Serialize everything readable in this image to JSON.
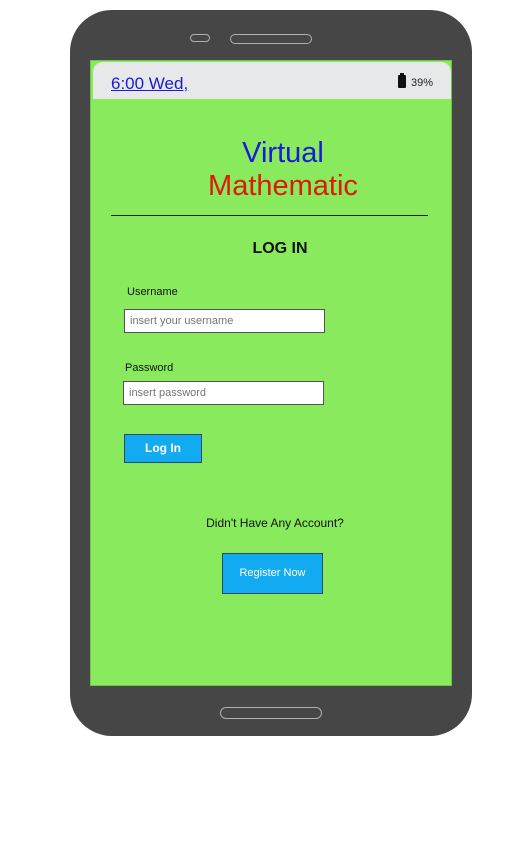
{
  "status_bar": {
    "time_date": "6:00  Wed,",
    "battery_percent": "39%",
    "battery_icon": "battery-icon"
  },
  "app": {
    "title_line1": "Virtual",
    "title_line2": "Mathematic",
    "colors": {
      "background": "#88ea5c",
      "title_line1": "#1a1ad8",
      "title_line2": "#dd1a0a",
      "button": "#12aaf1"
    }
  },
  "login_form": {
    "heading": "LOG IN",
    "username_label": "Username",
    "username_placeholder": "insert your username",
    "username_value": "",
    "password_label": "Password",
    "password_placeholder": "insert password",
    "password_value": "",
    "submit_label": "Log In"
  },
  "register": {
    "prompt": "Didn't Have Any Account?",
    "button_label": "Register Now"
  }
}
